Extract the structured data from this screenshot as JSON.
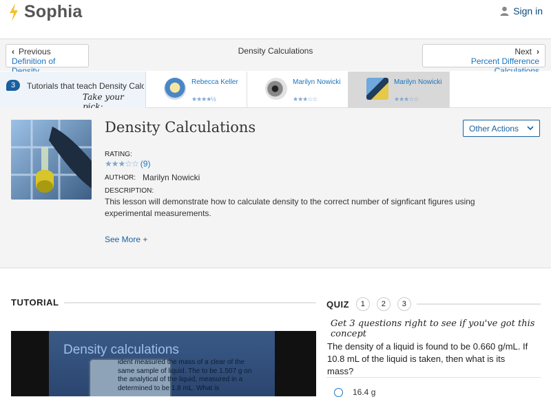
{
  "header": {
    "brand": "Sophia",
    "signin_label": "Sign in"
  },
  "nav": {
    "prev_label": "Previous",
    "prev_title": "Definition of Density",
    "current_title": "Density Calculations",
    "next_label": "Next",
    "next_title": "Percent Difference Calculations"
  },
  "tutorials": {
    "count": "3",
    "count_text": "Tutorials that teach Density Calculations",
    "pick_text": "Take your pick:",
    "items": [
      {
        "author": "Rebecca Keller",
        "stars": "★★★★½",
        "rating": 4.5
      },
      {
        "author": "Marilyn Nowicki",
        "stars": "★★★☆☆",
        "rating": 3
      },
      {
        "author": "Marilyn Nowicki",
        "stars": "★★★☆☆",
        "rating": 3,
        "selected": true
      }
    ]
  },
  "lesson": {
    "title": "Density Calculations",
    "other_actions": "Other Actions",
    "rating_label": "RATING:",
    "rating_stars": "★★★☆☆",
    "rating_count": "(9)",
    "author_label": "AUTHOR:",
    "author": "Marilyn Nowicki",
    "description_label": "DESCRIPTION:",
    "description": "This lesson will demonstrate how to calculate density to the correct number of signficant figures using experimental measurements.",
    "see_more": "See More +"
  },
  "tutorial_section": {
    "heading": "TUTORIAL",
    "slide_title": "Density calculations",
    "slide_text": "ident measured the mass of a clear of the same sample of liquid. The to be 1.507 g on the analytical of the liquid, measured in a determined to be 1.8 mL. What is"
  },
  "quiz": {
    "heading": "QUIZ",
    "numbers": [
      "1",
      "2",
      "3"
    ],
    "subtitle": "Get 3 questions right to see if you've got this concept",
    "question": "The density of a liquid is found to be 0.660 g/mL. If 10.8 mL of the liquid is taken, then what is its mass?",
    "answers": [
      "16.4 g"
    ]
  },
  "colors": {
    "accent": "#1a5f9e",
    "link": "#1a73c0",
    "logo": "#f2c230"
  }
}
